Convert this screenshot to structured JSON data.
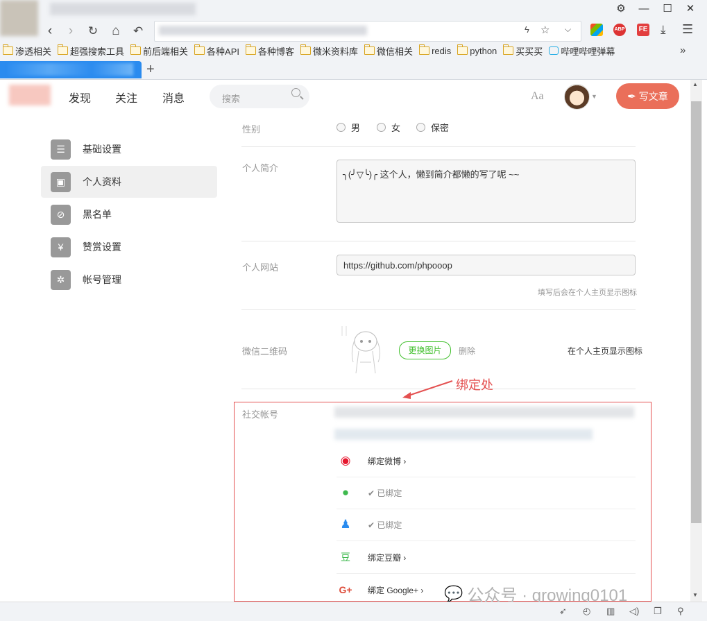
{
  "browser": {
    "window_controls": [
      "⚙",
      "—",
      "☐",
      "✕"
    ],
    "bookmarks": [
      "渗透相关",
      "超强搜索工具",
      "前后端相关",
      "各种API",
      "各种博客",
      "微米资料库",
      "微信相关",
      "redis",
      "python",
      "买买买",
      "哔哩哔哩弹幕"
    ],
    "bookmarks_more": "»",
    "new_tab": "+",
    "toolbar_badges": {
      "abp": "ABP",
      "fe": "FE"
    }
  },
  "site": {
    "nav": {
      "discover": "发现",
      "follow": "关注",
      "messages": "消息"
    },
    "search_placeholder": "搜索",
    "font_setting": "Aa",
    "write_button": "写文章"
  },
  "sidebar": {
    "items": [
      {
        "label": "基础设置",
        "icon": "list-icon"
      },
      {
        "label": "个人资料",
        "icon": "profile-card-icon"
      },
      {
        "label": "黑名单",
        "icon": "ban-icon"
      },
      {
        "label": "赞赏设置",
        "icon": "yen-icon"
      },
      {
        "label": "帐号管理",
        "icon": "gear-icon"
      }
    ]
  },
  "form": {
    "gender": {
      "label": "性别",
      "options": [
        "男",
        "女",
        "保密"
      ]
    },
    "bio": {
      "label": "个人简介",
      "value": "╮(╯▽╰)╭ 这个人，懒到简介都懒的写了呢 ~~"
    },
    "website": {
      "label": "个人网站",
      "value": "https://github.com/phpooop",
      "hint": "填写后会在个人主页显示图标"
    },
    "wechat_qr": {
      "label": "微信二维码",
      "change_button": "更换图片",
      "delete_link": "删除",
      "hint": "在个人主页显示图标"
    },
    "social": {
      "label": "社交帐号",
      "annotation": "绑定处",
      "rows": [
        {
          "icon": "weibo-icon",
          "text": "绑定微博 ›",
          "bound": false
        },
        {
          "icon": "wechat-icon",
          "text": "✔ 已绑定",
          "bound": true
        },
        {
          "icon": "qq-icon",
          "text": "✔ 已绑定",
          "bound": true
        },
        {
          "icon": "douban-icon",
          "text": "绑定豆瓣 ›",
          "bound": false
        },
        {
          "icon": "google-plus-icon",
          "text": "绑定 Google+ ›",
          "bound": false
        }
      ]
    }
  },
  "watermark": "公众号 · growing0101",
  "colors": {
    "accent": "#ea6f5a",
    "green": "#42c02e",
    "annotation": "#e45050",
    "tab": "#2a8bef"
  }
}
